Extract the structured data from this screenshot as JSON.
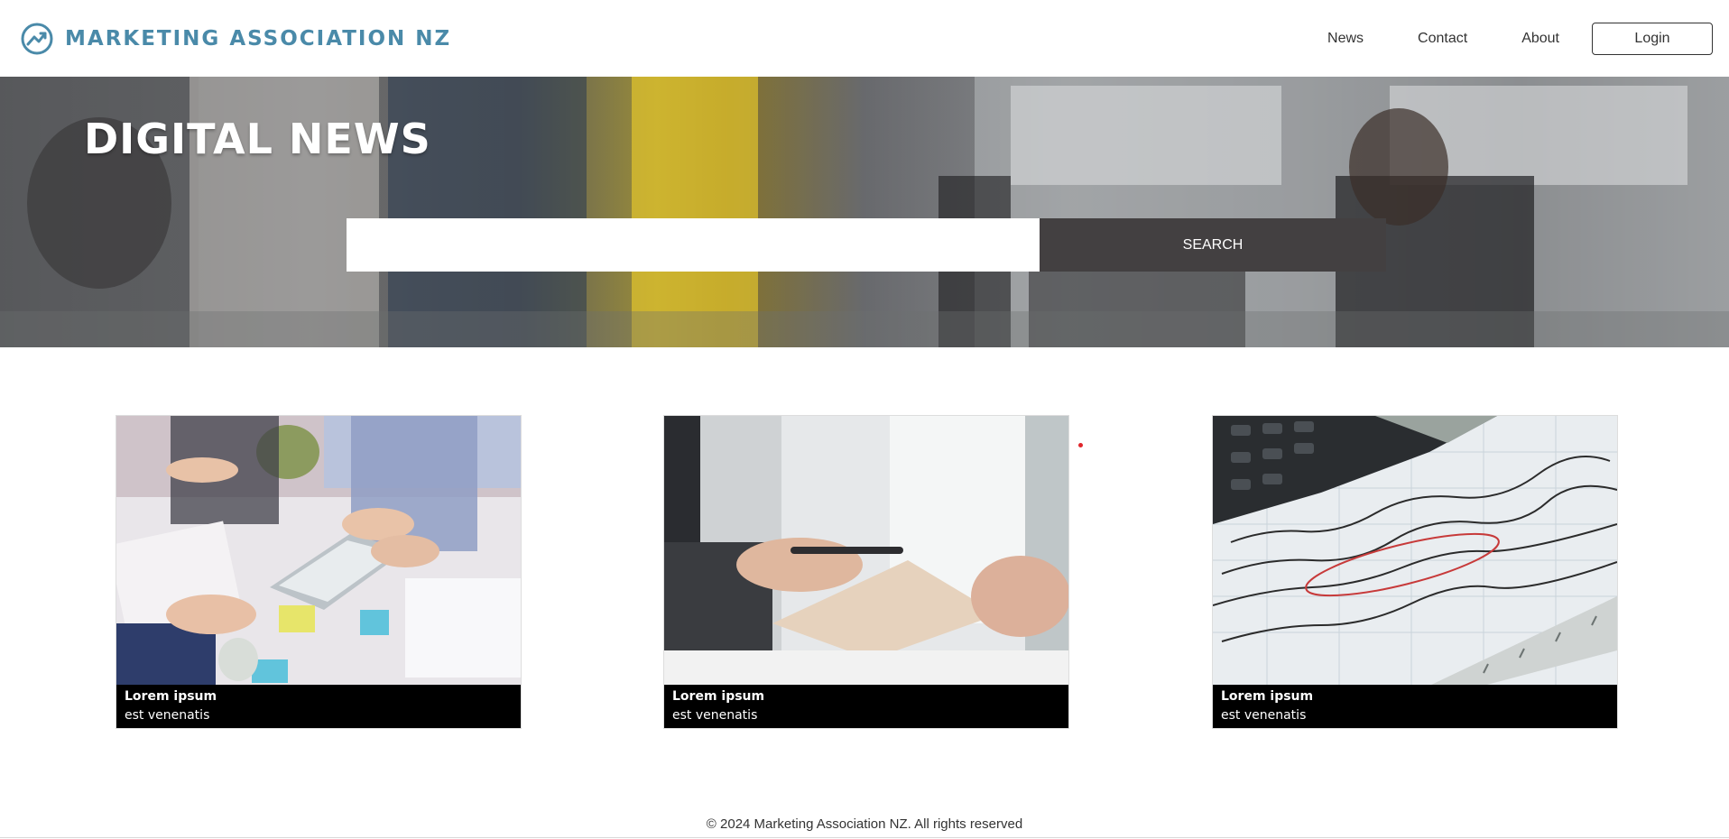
{
  "header": {
    "brand": "MARKETING ASSOCIATION NZ",
    "nav": [
      {
        "label": "News"
      },
      {
        "label": "Contact"
      },
      {
        "label": "About"
      }
    ],
    "login_label": "Login"
  },
  "hero": {
    "title": "DIGITAL NEWS",
    "search_placeholder": "",
    "search_value": "",
    "search_button": "SEARCH"
  },
  "cards": [
    {
      "title": "Lorem ipsum",
      "subtitle": "est venenatis"
    },
    {
      "title": "Lorem ipsum",
      "subtitle": "est venenatis"
    },
    {
      "title": "Lorem ipsum",
      "subtitle": "est venenatis"
    }
  ],
  "footer": {
    "text": "© 2024 Marketing Association NZ. All rights reserved"
  },
  "colors": {
    "brand": "#4a8aa9",
    "search_button": "#434041",
    "caption_bg": "#000000"
  }
}
